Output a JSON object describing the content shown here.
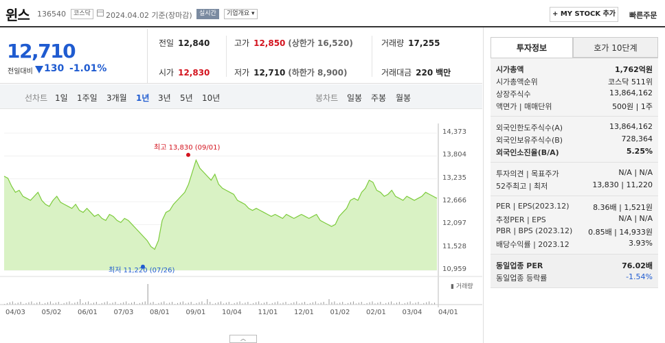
{
  "header": {
    "name": "윈스",
    "code": "136540",
    "market_badge": "코스닥",
    "date": "2024.04.02",
    "basis": "기준(장마감)",
    "live_badge": "실시간",
    "corp_badge": "기업개요 ▾",
    "mystock_button": "+ MY STOCK 추가",
    "quick_order": "빠른주문"
  },
  "price": {
    "current": "12,710",
    "change_label": "전일대비",
    "change_value": "130",
    "change_pct": "-1.01%"
  },
  "stats": {
    "prev_label": "전일",
    "prev": "12,840",
    "open_label": "시가",
    "open": "12,830",
    "high_label": "고가",
    "high": "12,850",
    "upper_limit_label": "(상한가",
    "upper_limit": "16,520)",
    "low_label": "저가",
    "low": "12,710",
    "lower_limit_label": "(하한가",
    "lower_limit": "8,900)",
    "volume_label": "거래량",
    "volume": "17,255",
    "amount_label": "거래대금",
    "amount": "220",
    "amount_unit": "백만"
  },
  "tabs": {
    "line_label": "선차트",
    "line": [
      "1일",
      "1주일",
      "3개월",
      "1년",
      "3년",
      "5년",
      "10년"
    ],
    "candle_label": "봉차트",
    "candle": [
      "일봉",
      "주봉",
      "월봉"
    ],
    "active": "1년"
  },
  "chart_data": {
    "type": "area",
    "ylim": [
      10959,
      14373
    ],
    "yticks": [
      "14,373",
      "13,804",
      "13,235",
      "12,666",
      "12,097",
      "11,528",
      "10,959"
    ],
    "xticks": [
      "04/03",
      "05/02",
      "06/01",
      "07/03",
      "08/01",
      "09/01",
      "10/04",
      "11/01",
      "12/01",
      "01/02",
      "02/01",
      "03/04",
      "04/01"
    ],
    "high_annotation": "최고 13,830 (09/01)",
    "low_annotation": "최저 11,220 (07/26)",
    "volume_label": "거래량",
    "values": [
      13300,
      13250,
      13050,
      12900,
      12950,
      12800,
      12750,
      12700,
      12800,
      12900,
      12700,
      12600,
      12550,
      12700,
      12800,
      12650,
      12600,
      12550,
      12500,
      12600,
      12450,
      12400,
      12500,
      12400,
      12300,
      12350,
      12250,
      12200,
      12350,
      12300,
      12200,
      12150,
      12250,
      12200,
      12100,
      12000,
      11900,
      11800,
      11700,
      11550,
      11480,
      11700,
      12200,
      12400,
      12450,
      12600,
      12700,
      12800,
      12900,
      13100,
      13400,
      13700,
      13500,
      13400,
      13300,
      13200,
      13350,
      13100,
      13000,
      12950,
      12900,
      12850,
      12700,
      12650,
      12600,
      12500,
      12450,
      12500,
      12450,
      12400,
      12350,
      12300,
      12350,
      12300,
      12250,
      12350,
      12300,
      12250,
      12300,
      12350,
      12300,
      12250,
      12300,
      12350,
      12200,
      12150,
      12100,
      12050,
      12100,
      12300,
      12400,
      12500,
      12700,
      12750,
      12700,
      12900,
      13000,
      13200,
      13150,
      12950,
      12900,
      12800,
      12850,
      12950,
      12800,
      12750,
      12700,
      12800,
      12750,
      12700,
      12750,
      12800,
      12900,
      12850,
      12800,
      12750
    ]
  },
  "right_panel": {
    "tab_info": "투자정보",
    "tab_orderbook": "호가 10단계",
    "s1": [
      {
        "l": "시가총액",
        "r": "1,762억원"
      },
      {
        "l": "시가총액순위",
        "r": "코스닥 511위"
      },
      {
        "l": "상장주식수",
        "r": "13,864,162"
      },
      {
        "l": "액면가 | 매매단위",
        "r": "500원 | 1주"
      }
    ],
    "s2": [
      {
        "l": "외국인한도주식수(A)",
        "r": "13,864,162"
      },
      {
        "l": "외국인보유주식수(B)",
        "r": "728,364"
      },
      {
        "l": "외국인소진율(B/A)",
        "r": "5.25%"
      }
    ],
    "s3": [
      {
        "l": "투자의견 | 목표주가",
        "r": "N/A | N/A"
      },
      {
        "l": "52주최고 | 최저",
        "r": "13,830 | 11,220"
      }
    ],
    "s4": [
      {
        "l": "PER | EPS(2023.12)",
        "r": "8.36배 | 1,521원"
      },
      {
        "l": "추정PER | EPS",
        "r": "N/A | N/A"
      },
      {
        "l": "PBR | BPS (2023.12)",
        "r": "0.85배 | 14,933원"
      },
      {
        "l": "배당수익률 | 2023.12",
        "r": "3.93%"
      }
    ],
    "s5": [
      {
        "l": "동일업종 PER",
        "r": "76.02배"
      },
      {
        "l": "동일업종 등락률",
        "r": "-1.54%"
      }
    ]
  }
}
